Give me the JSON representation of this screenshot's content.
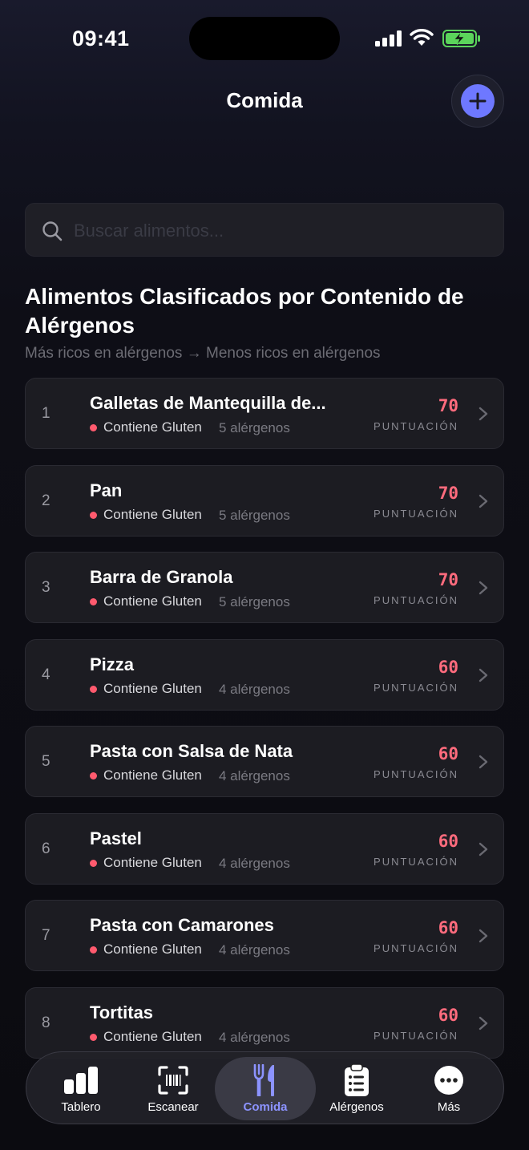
{
  "status": {
    "time": "09:41"
  },
  "header": {
    "title": "Comida",
    "add_icon": "plus-icon"
  },
  "search": {
    "placeholder": "Buscar alimentos..."
  },
  "section": {
    "title": "Alimentos Clasificados por Contenido de Alérgenos",
    "subtitle": "Más ricos en alérgenos → Menos ricos en alérgenos"
  },
  "foods": [
    {
      "rank": "1",
      "name": "Galletas de Mantequilla de...",
      "tag": "Contiene Gluten",
      "allergens": "5 alérgenos",
      "score": "70",
      "score_label": "PUNTUACIÓN"
    },
    {
      "rank": "2",
      "name": "Pan",
      "tag": "Contiene Gluten",
      "allergens": "5 alérgenos",
      "score": "70",
      "score_label": "PUNTUACIÓN"
    },
    {
      "rank": "3",
      "name": "Barra de Granola",
      "tag": "Contiene Gluten",
      "allergens": "5 alérgenos",
      "score": "70",
      "score_label": "PUNTUACIÓN"
    },
    {
      "rank": "4",
      "name": "Pizza",
      "tag": "Contiene Gluten",
      "allergens": "4 alérgenos",
      "score": "60",
      "score_label": "PUNTUACIÓN"
    },
    {
      "rank": "5",
      "name": "Pasta con Salsa de Nata",
      "tag": "Contiene Gluten",
      "allergens": "4 alérgenos",
      "score": "60",
      "score_label": "PUNTUACIÓN"
    },
    {
      "rank": "6",
      "name": "Pastel",
      "tag": "Contiene Gluten",
      "allergens": "4 alérgenos",
      "score": "60",
      "score_label": "PUNTUACIÓN"
    },
    {
      "rank": "7",
      "name": "Pasta con Camarones",
      "tag": "Contiene Gluten",
      "allergens": "4 alérgenos",
      "score": "60",
      "score_label": "PUNTUACIÓN"
    },
    {
      "rank": "8",
      "name": "Tortitas",
      "tag": "Contiene Gluten",
      "allergens": "4 alérgenos",
      "score": "60",
      "score_label": "PUNTUACIÓN"
    }
  ],
  "tabbar": {
    "tabs": [
      {
        "label": "Tablero",
        "icon": "bar-chart-icon"
      },
      {
        "label": "Escanear",
        "icon": "barcode-scan-icon"
      },
      {
        "label": "Comida",
        "icon": "fork-knife-icon",
        "active": true
      },
      {
        "label": "Alérgenos",
        "icon": "clipboard-list-icon"
      },
      {
        "label": "Más",
        "icon": "more-dots-icon"
      }
    ]
  },
  "colors": {
    "accent": "#6e78ff",
    "score": "#ff6b7d",
    "active_tab": "#8c93ff",
    "gluten_dot": "#ff5a6e"
  }
}
